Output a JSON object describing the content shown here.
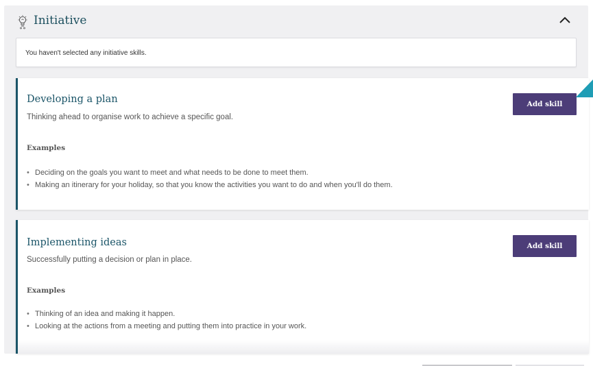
{
  "section": {
    "title": "Initiative",
    "icon": "lightbulb-icon"
  },
  "notice": {
    "text": "You haven't selected any initiative skills."
  },
  "skills": [
    {
      "title": "Developing a plan",
      "description": "Thinking ahead to organise work to achieve a specific goal.",
      "examples_label": "Examples",
      "examples": [
        "Deciding on the goals you want to meet and what needs to be done to meet them.",
        "Making an itinerary for your holiday, so that you know the activities you want to do and when you'll do them."
      ],
      "button_label": "Add skill"
    },
    {
      "title": "Implementing ideas",
      "description": "Successfully putting a decision or plan in place.",
      "examples_label": "Examples",
      "examples": [
        "Thinking of an idea and making it happen.",
        "Looking at the actions from a meeting and putting them into practice in your work."
      ],
      "button_label": "Add skill"
    }
  ],
  "colors": {
    "accent": "#1b5568",
    "button": "#4c3d78",
    "pointer": "#1f9db5"
  }
}
